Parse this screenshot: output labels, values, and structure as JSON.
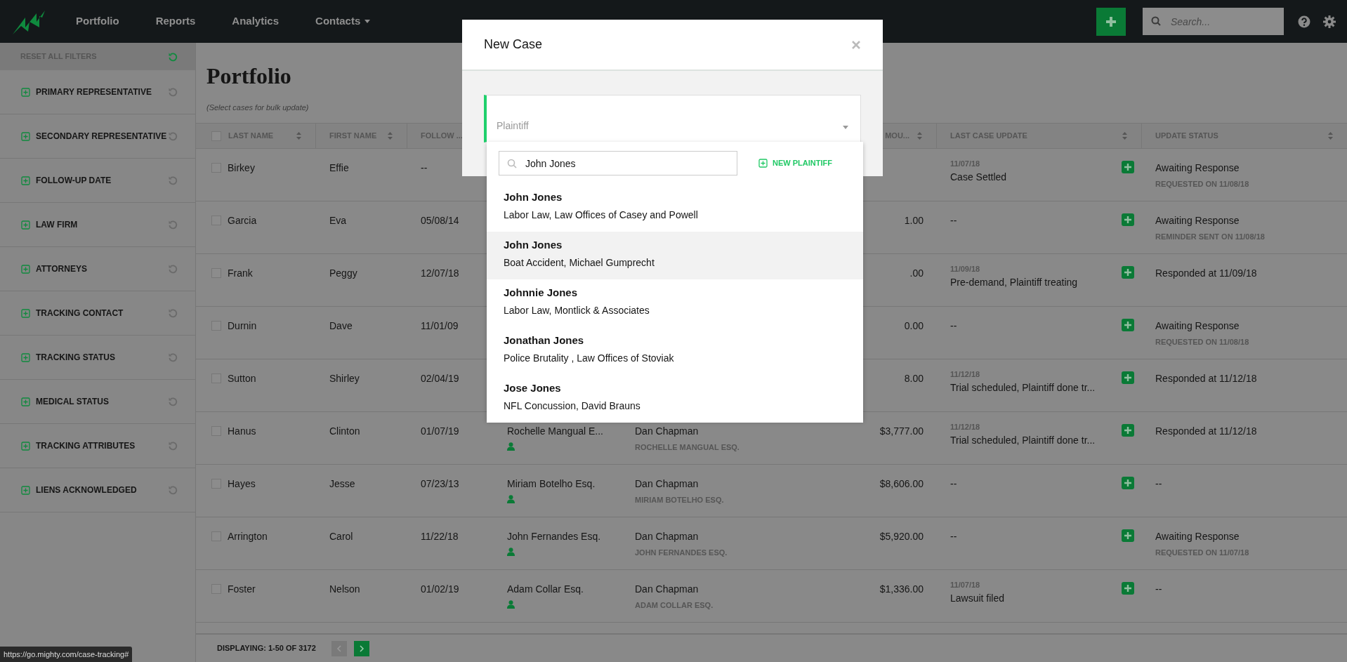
{
  "nav": {
    "items": [
      {
        "label": "Portfolio",
        "has_menu": false
      },
      {
        "label": "Reports",
        "has_menu": false
      },
      {
        "label": "Analytics",
        "has_menu": false
      },
      {
        "label": "Contacts",
        "has_menu": true
      }
    ],
    "search": {
      "placeholder": "Search..."
    }
  },
  "sidebar": {
    "reset_label": "RESET ALL FILTERS",
    "filters": [
      {
        "label": "PRIMARY REPRESENTATIVE"
      },
      {
        "label": "SECONDARY REPRESENTATIVE"
      },
      {
        "label": "FOLLOW-UP DATE"
      },
      {
        "label": "LAW FIRM"
      },
      {
        "label": "ATTORNEYS"
      },
      {
        "label": "TRACKING CONTACT"
      },
      {
        "label": "TRACKING STATUS"
      },
      {
        "label": "MEDICAL STATUS"
      },
      {
        "label": "TRACKING ATTRIBUTES"
      },
      {
        "label": "LIENS ACKNOWLEDGED"
      }
    ]
  },
  "page": {
    "title": "Portfolio",
    "subtitle": "(Select cases for bulk update)"
  },
  "table": {
    "select_all_checked": false,
    "columns": [
      {
        "label": "LAST NAME",
        "sortable": true
      },
      {
        "label": "FIRST NAME",
        "sortable": true
      },
      {
        "label": "FOLLOW ...",
        "sortable": false
      },
      {
        "label": "MOU...",
        "sortable": true
      },
      {
        "label": "LAST CASE UPDATE",
        "sortable": true
      },
      {
        "label": "UPDATE STATUS",
        "sortable": true
      }
    ],
    "rows": [
      {
        "checked": false,
        "last_name": "Birkey",
        "first_name": "Effie",
        "follow_up": "--",
        "update_date": "11/07/18",
        "update_text": "Case Settled",
        "status": "Awaiting Response",
        "status_sub": "REQUESTED ON 11/08/18"
      },
      {
        "checked": false,
        "last_name": "Garcia",
        "first_name": "Eva",
        "follow_up": "05/08/14",
        "amount": "1.00",
        "update_text": "--",
        "status": "Awaiting Response",
        "status_sub": "REMINDER SENT ON 11/08/18"
      },
      {
        "checked": false,
        "last_name": "Frank",
        "first_name": "Peggy",
        "follow_up": "12/07/18",
        "amount": ".00",
        "update_date": "11/09/18",
        "update_text": "Pre-demand, Plaintiff treating",
        "status": "Responded at 11/09/18"
      },
      {
        "checked": false,
        "last_name": "Durnin",
        "first_name": "Dave",
        "follow_up": "11/01/09",
        "amount": "0.00",
        "update_text": "--",
        "status": "Awaiting Response",
        "status_sub": "REQUESTED ON 11/08/18"
      },
      {
        "checked": false,
        "last_name": "Sutton",
        "first_name": "Shirley",
        "follow_up": "02/04/19",
        "amount": "8.00",
        "update_date": "11/12/18",
        "update_text": "Trial scheduled, Plaintiff done tr...",
        "status": "Responded at 11/12/18"
      },
      {
        "checked": false,
        "last_name": "Hanus",
        "first_name": "Clinton",
        "follow_up": "01/07/19",
        "attorney": "Rochelle Mangual E...",
        "rep": "Dan Chapman",
        "rep_sub": "ROCHELLE MANGUAL ESQ.",
        "amount": "$3,777.00",
        "update_date": "11/12/18",
        "update_text": "Trial scheduled, Plaintiff done tr...",
        "status": "Responded at 11/12/18"
      },
      {
        "checked": false,
        "last_name": "Hayes",
        "first_name": "Jesse",
        "follow_up": "07/23/13",
        "attorney": "Miriam Botelho Esq.",
        "rep": "Dan Chapman",
        "rep_sub": "MIRIAM BOTELHO ESQ.",
        "amount": "$8,606.00",
        "update_text": "--",
        "status": "--"
      },
      {
        "checked": false,
        "last_name": "Arrington",
        "first_name": "Carol",
        "follow_up": "11/22/18",
        "attorney": "John Fernandes Esq.",
        "rep": "Dan Chapman",
        "rep_sub": "JOHN FERNANDES ESQ.",
        "amount": "$5,920.00",
        "update_text": "--",
        "status": "Awaiting Response",
        "status_sub": "REQUESTED ON 11/07/18"
      },
      {
        "checked": false,
        "last_name": "Foster",
        "first_name": "Nelson",
        "follow_up": "01/02/19",
        "attorney": "Adam Collar Esq.",
        "rep": "Dan Chapman",
        "rep_sub": "ADAM COLLAR ESQ.",
        "amount": "$1,336.00",
        "update_date": "11/07/18",
        "update_text": "Lawsuit filed",
        "status": "--"
      }
    ]
  },
  "footer": {
    "displaying": "DISPLAYING: 1-50 OF 3172",
    "pager": [
      {
        "kind": "prev",
        "disabled": true
      },
      {
        "kind": "next",
        "disabled": false
      }
    ]
  },
  "status_url": "https://go.mighty.com/case-tracking#",
  "modal": {
    "title": "New Case",
    "field": {
      "placeholder": "Plaintiff"
    },
    "dropdown": {
      "search_value": "John Jones",
      "new_button": "NEW PLAINTIFF",
      "options": [
        {
          "name": "John Jones",
          "detail": "Labor Law, Law Offices of Casey and Powell",
          "selected": false
        },
        {
          "name": "John Jones",
          "detail": "Boat Accident, Michael Gumprecht",
          "selected": true
        },
        {
          "name": "Johnnie Jones",
          "detail": "Labor Law, Montlick & Associates",
          "selected": false
        },
        {
          "name": "Jonathan Jones",
          "detail": "Police Brutality , Law Offices of Stoviak",
          "selected": false
        },
        {
          "name": "Jose Jones",
          "detail": "NFL Concussion, David Brauns",
          "selected": false
        }
      ]
    }
  }
}
